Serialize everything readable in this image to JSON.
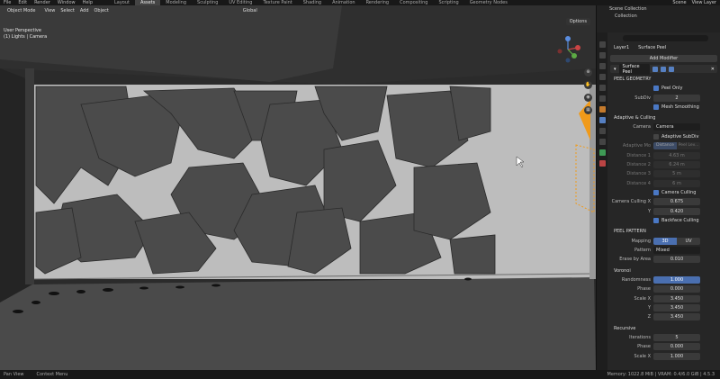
{
  "topbar": {
    "menus": [
      "File",
      "Edit",
      "Render",
      "Window",
      "Help"
    ],
    "workspaces": [
      "Layout",
      "Assets",
      "Modeling",
      "Sculpting",
      "UV Editing",
      "Texture Paint",
      "Shading",
      "Animation",
      "Rendering",
      "Compositing",
      "Scripting",
      "Geometry Nodes"
    ],
    "active_workspace": "Assets",
    "scene_label": "Scene",
    "view_layer": "View Layer"
  },
  "viewport": {
    "mode": "Object Mode",
    "menus": [
      "View",
      "Select",
      "Add",
      "Object"
    ],
    "orientation": "Global",
    "info_line1": "User Perspective",
    "info_line2": "(1) Lights | Camera",
    "options": "Options"
  },
  "outliner": {
    "rows": [
      "Scene Collection",
      "Collection"
    ]
  },
  "properties": {
    "breadcrumb": [
      "Layer1",
      "Surface Peel"
    ],
    "add_modifier": "Add Modifier",
    "modifier_name": "Surface Peel",
    "peel_geometry": {
      "title": "PEEL GEOMETRY",
      "peel_only": "Peel Only",
      "subdiv_label": "SubDiv",
      "subdiv_value": "2",
      "mesh_smoothing": "Mesh Smoothing"
    },
    "adaptive": {
      "title": "Adaptive & Culling",
      "camera_label": "Camera",
      "camera_value": "Camera",
      "adaptive_subdiv": "Adaptive SubDiv",
      "adaptive_mode_label": "Adaptive Mo",
      "adaptive_mode_options": [
        "Distance",
        "Peel Lev..."
      ],
      "distances": [
        {
          "label": "Distance 1",
          "value": "4.63 m"
        },
        {
          "label": "Distance 2",
          "value": "6.24 m"
        },
        {
          "label": "Distance 3",
          "value": "5 m"
        },
        {
          "label": "Distance 4",
          "value": "6 m"
        }
      ],
      "camera_culling": "Camera Culling",
      "camera_culling_label": "Camera Culling X",
      "culling_x": "0.675",
      "culling_y_label": "Y",
      "culling_y": "0.420",
      "backface_culling": "Backface Culling"
    },
    "peel_pattern": {
      "title": "PEEL PATTERN",
      "mapping_label": "Mapping",
      "mapping_options": [
        "3D",
        "UV"
      ],
      "pattern_label": "Pattern",
      "pattern_value": "Mixed",
      "erase_label": "Erase by Area",
      "erase_value": "0.010"
    },
    "voronoi": {
      "title": "Voronoi",
      "rows": [
        {
          "label": "Randomness",
          "value": "1.000"
        },
        {
          "label": "Phase",
          "value": "0.000"
        },
        {
          "label": "Scale X",
          "value": "3.450"
        },
        {
          "label": "Y",
          "value": "3.450"
        },
        {
          "label": "Z",
          "value": "3.450"
        }
      ]
    },
    "recursive": {
      "title": "Recursive",
      "rows": [
        {
          "label": "Iterations",
          "value": "5"
        },
        {
          "label": "Phase",
          "value": "0.000"
        },
        {
          "label": "Scale X",
          "value": "1.000"
        }
      ]
    }
  },
  "statusbar": {
    "left1": "Pan View",
    "left2": "Context Menu",
    "right": "Memory: 1022.8 MiB | VRAM: 0.4/6.0 GiB | 4.5.3"
  },
  "colors": {
    "accent": "#4a6fb0",
    "camera_orange": "#f09a1a"
  }
}
